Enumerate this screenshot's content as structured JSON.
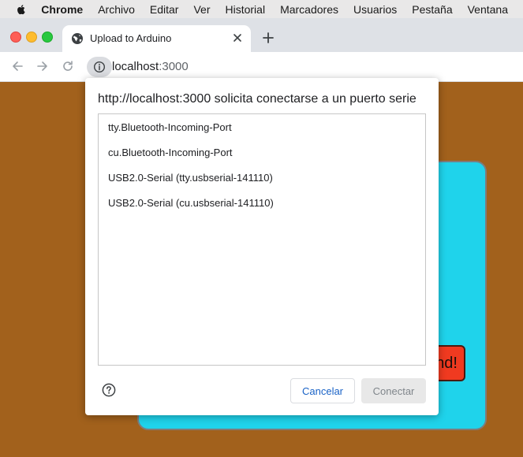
{
  "menubar": {
    "app_name": "Chrome",
    "items": [
      "Archivo",
      "Editar",
      "Ver",
      "Historial",
      "Marcadores",
      "Usuarios",
      "Pestaña",
      "Ventana"
    ]
  },
  "tab": {
    "title": "Upload to Arduino"
  },
  "address": {
    "host": "localhost",
    "port": ":3000"
  },
  "page": {
    "button_label": "nd!"
  },
  "dialog": {
    "heading": "http://localhost:3000 solicita conectarse a un puerto serie",
    "ports": [
      "tty.Bluetooth-Incoming-Port",
      "cu.Bluetooth-Incoming-Port",
      "USB2.0-Serial (tty.usbserial-141110)",
      "USB2.0-Serial (cu.usbserial-141110)"
    ],
    "cancel_label": "Cancelar",
    "connect_label": "Conectar"
  },
  "colors": {
    "page_background": "#a2611c",
    "card": "#1fd3eb",
    "page_button": "#f03a20",
    "link_blue": "#1a63c7"
  }
}
